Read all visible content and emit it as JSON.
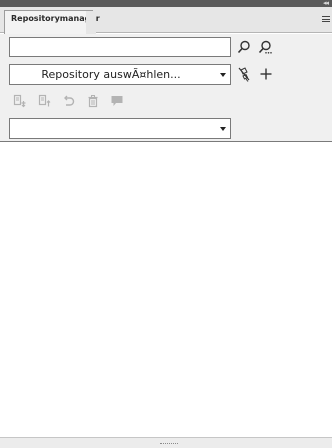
{
  "panel": {
    "tab_label": "Repositorymanager",
    "collapse_glyph": "◂◂"
  },
  "search": {
    "value": "",
    "placeholder": ""
  },
  "repository": {
    "select_label": "Repository auswÃ¤hlen..."
  },
  "filter": {
    "selected_value": ""
  },
  "icons": {
    "search": "magnifier-icon",
    "advanced_search": "magnifier-ellipsis-icon",
    "disconnect": "unplug-icon",
    "add": "plus-icon",
    "checkout": "checkout-icon",
    "checkin": "checkin-icon",
    "undo": "undo-icon",
    "delete": "trash-icon",
    "comment": "comment-icon"
  },
  "colors": {
    "toolbar_bg": "#f0f0f0",
    "disabled_icon": "#b3b3b3",
    "active_icon": "#333333"
  }
}
